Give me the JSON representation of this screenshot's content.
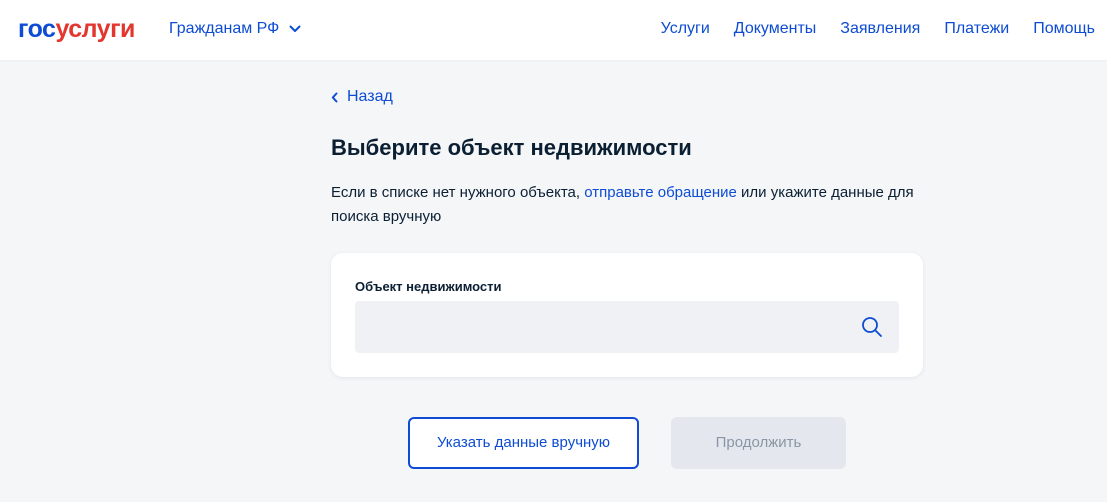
{
  "header": {
    "logo_part1": "гос",
    "logo_part2": "услуги",
    "region": "Гражданам РФ",
    "nav": [
      "Услуги",
      "Документы",
      "Заявления",
      "Платежи",
      "Помощь"
    ]
  },
  "back_label": "Назад",
  "title": "Выберите объект недвижимости",
  "description": {
    "before": "Если в списке нет нужного объекта, ",
    "link": "отправьте обращение",
    "after": " или укажите данные для поиска вручную"
  },
  "field": {
    "label": "Объект недвижимости",
    "value": "",
    "placeholder": ""
  },
  "buttons": {
    "manual": "Указать данные вручную",
    "continue": "Продолжить"
  },
  "colors": {
    "brand_blue": "#0d4cd3",
    "brand_red": "#e3362f",
    "page_bg": "#f5f6f8",
    "disabled_bg": "#e4e8ee",
    "disabled_text": "#8b96a4"
  }
}
